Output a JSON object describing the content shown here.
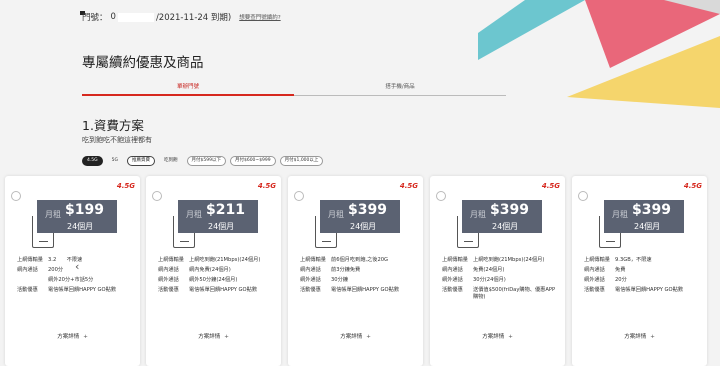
{
  "header": {
    "number_label": "門號：",
    "number_prefix": "0",
    "number_suffix": "/2021-11-24 到期)",
    "forgot_link": "想要查門號續約?"
  },
  "section_title": "專屬續約優惠及商品",
  "tabs": [
    {
      "label": "單辦門號",
      "active": true
    },
    {
      "label": "搭手機/商品",
      "active": false
    }
  ],
  "plan_title": "1.資費方案",
  "plan_subtitle": "吃到飽吃不飽這裡都有",
  "filters": [
    "4.5G",
    "5G",
    "推薦資費",
    "吃到飽",
    "月付$599以下",
    "月付$600~$999",
    "月付$1,000以上"
  ],
  "cards": [
    {
      "badge": "4.5G",
      "prefix": "月租",
      "price": "$199",
      "duration": "24個月",
      "rows": [
        {
          "k": "上網傳輸量",
          "v": "3.2　　不限速"
        },
        {
          "k": "網內通話",
          "v": "200分"
        },
        {
          "k": "",
          "v": "網外20分+市話5分"
        },
        {
          "k": "活動優惠",
          "v": "電信帳單回饋HAPPY GO點數"
        }
      ],
      "more": "方案詳情"
    },
    {
      "badge": "4.5G",
      "prefix": "月租",
      "price": "$211",
      "duration": "24個月",
      "rows": [
        {
          "k": "上網傳輸量",
          "v": "上網吃到飽(21Mbps)(24個月)"
        },
        {
          "k": "網內通話",
          "v": "網內免費(24個月)"
        },
        {
          "k": "網外通話",
          "v": "網外50分鐘(24個月)"
        },
        {
          "k": "活動優惠",
          "v": "電信帳單回饋HAPPY GO點數"
        }
      ],
      "more": "方案詳情"
    },
    {
      "badge": "4.5G",
      "prefix": "月租",
      "price": "$399",
      "duration": "24個月",
      "rows": [
        {
          "k": "上網傳輸量",
          "v": "前6個月吃到飽,之後20G"
        },
        {
          "k": "網內通話",
          "v": "前3分鐘免費"
        },
        {
          "k": "網外通話",
          "v": "30分鐘"
        },
        {
          "k": "活動優惠",
          "v": "電信帳單回饋HAPPY GO點數"
        }
      ],
      "more": "方案詳情"
    },
    {
      "badge": "4.5G",
      "prefix": "月租",
      "price": "$399",
      "duration": "24個月",
      "rows": [
        {
          "k": "上網傳輸量",
          "v": "上網吃到飽(21Mbps)(24個月)"
        },
        {
          "k": "網內通話",
          "v": "免費(24個月)"
        },
        {
          "k": "網外通話",
          "v": "30分(24個月)"
        },
        {
          "k": "活動優惠",
          "v": "送價值$500(friDay購物、優惠APP購物)"
        }
      ],
      "more": "方案詳情"
    },
    {
      "badge": "4.5G",
      "prefix": "月租",
      "price": "$399",
      "duration": "24個月",
      "rows": [
        {
          "k": "上網傳輸量",
          "v": "9.3GB，不限速"
        },
        {
          "k": "網內通話",
          "v": "免費"
        },
        {
          "k": "網外通話",
          "v": "20分"
        },
        {
          "k": "活動優惠",
          "v": "電信帳單回饋HAPPY GO點數"
        }
      ],
      "more": "方案詳情"
    }
  ],
  "carousel_prev": "‹"
}
